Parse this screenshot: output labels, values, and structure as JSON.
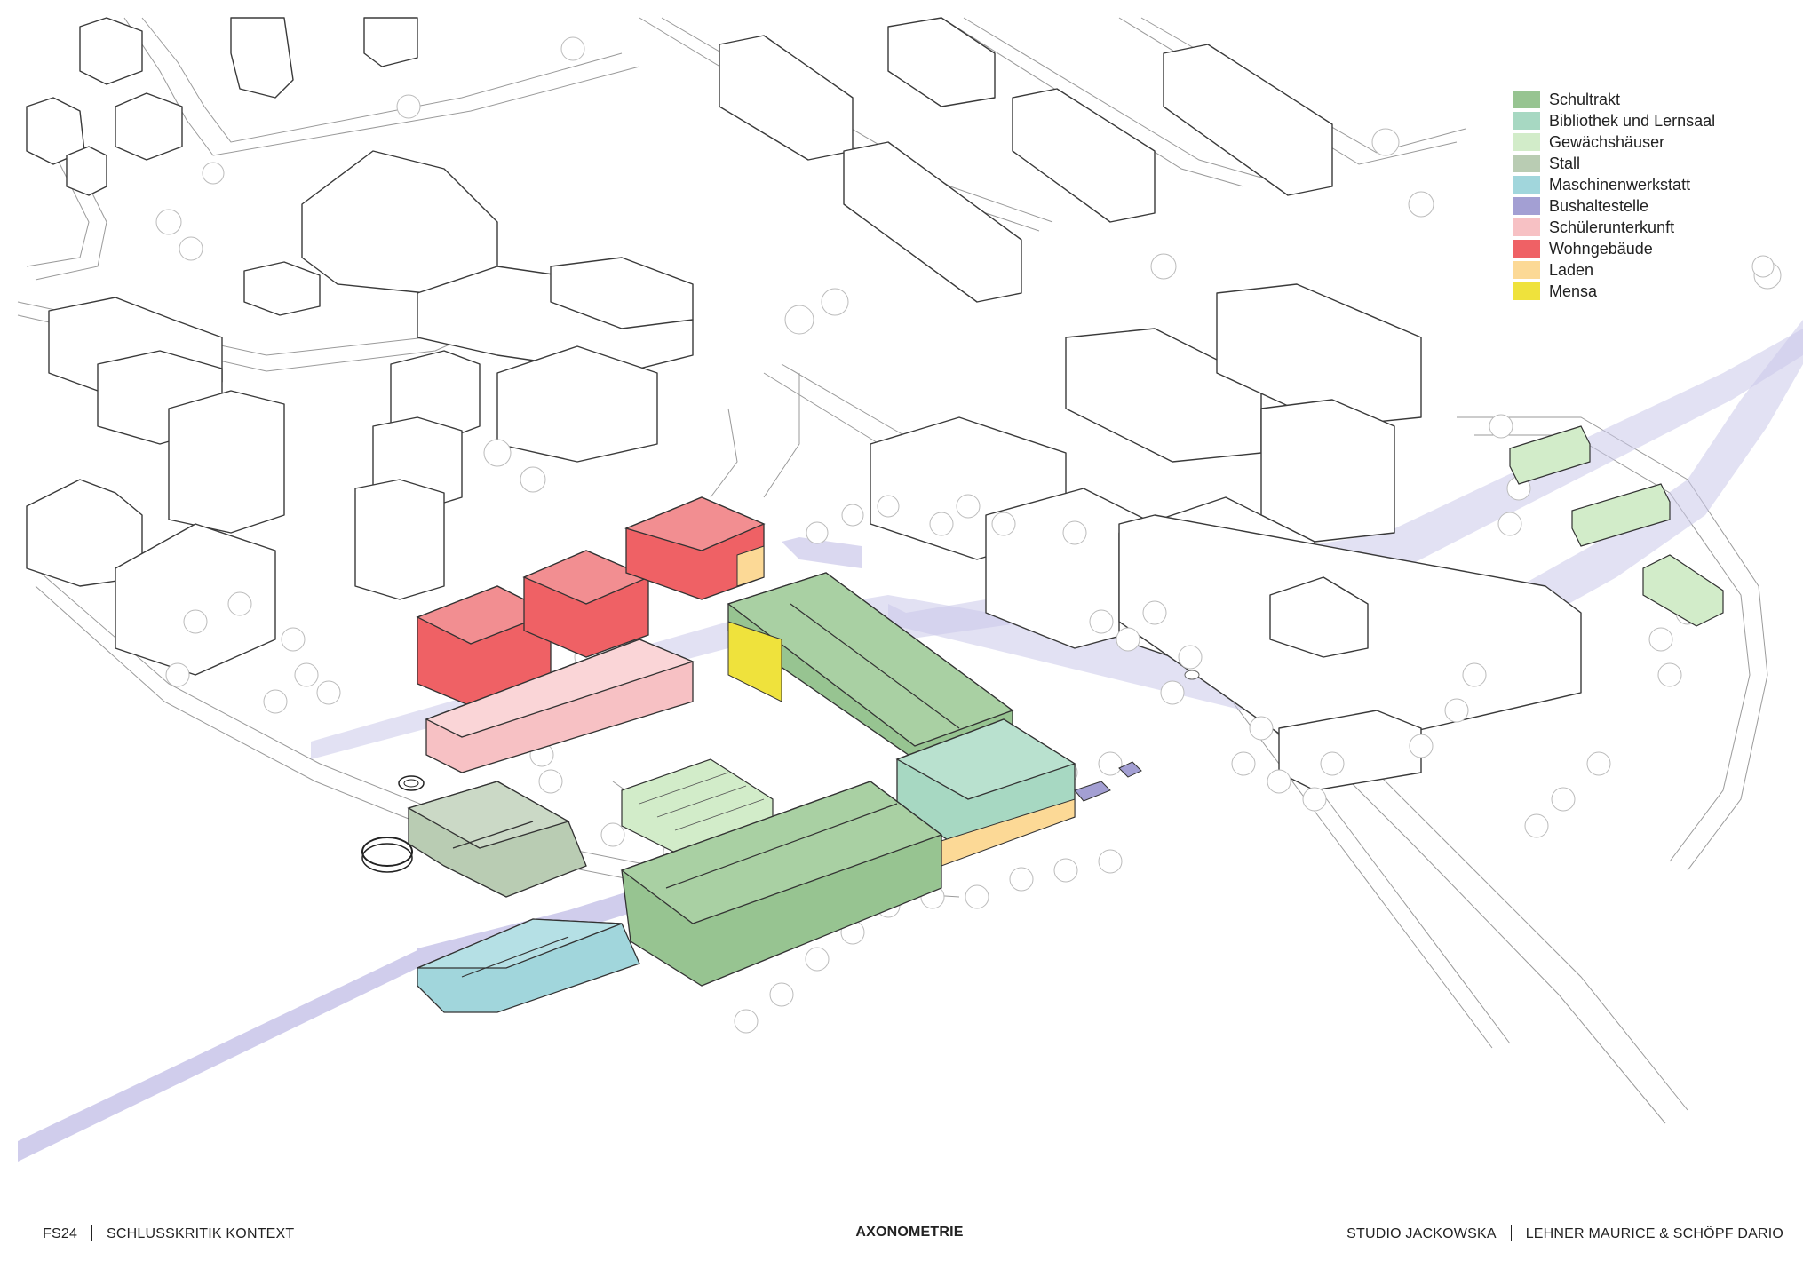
{
  "legend": {
    "items": [
      {
        "label": "Schultrakt",
        "color": "#97c491"
      },
      {
        "label": "Bibliothek und Lernsaal",
        "color": "#a7d8c2"
      },
      {
        "label": "Gewächshäuser",
        "color": "#d2ecc9"
      },
      {
        "label": "Stall",
        "color": "#b9ccb3"
      },
      {
        "label": "Maschinenwerkstatt",
        "color": "#a1d6dc"
      },
      {
        "label": "Bushaltestelle",
        "color": "#a39fd3"
      },
      {
        "label": "Schülerunterkunft",
        "color": "#f7c1c4"
      },
      {
        "label": "Wohngebäude",
        "color": "#ef6165"
      },
      {
        "label": "Laden",
        "color": "#fcd996"
      },
      {
        "label": "Mensa",
        "color": "#efe23c"
      }
    ]
  },
  "footer": {
    "left_code": "FS24",
    "left_title": "SCHLUSSKRITIK KONTEXT",
    "center_title": "AXONOMETRIE",
    "right_studio": "STUDIO JACKOWSKA",
    "right_authors": "LEHNER MAURICE & SCHÖPF DARIO"
  },
  "colors": {
    "path": "#cbc8ea",
    "line": "#3a3a3a"
  }
}
